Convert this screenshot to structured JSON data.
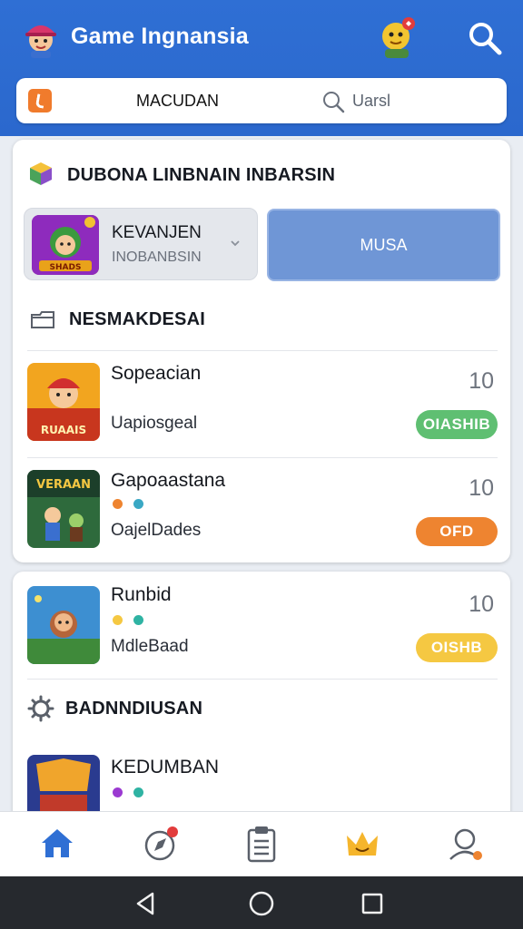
{
  "header": {
    "title": "Game Ingnansia",
    "logo_icon": "gamer-mascot-icon",
    "avatar_icon": "user-avatar-icon",
    "search_icon": "search-icon"
  },
  "search_bar": {
    "tab_label": "MACUDAN",
    "placeholder": "Uarsl"
  },
  "featured_section": {
    "title": "DUBONA LINBNAIN INBARSIN",
    "icon": "cube-icon",
    "featured": {
      "title": "KEVANJEN",
      "subtitle": "INOBANBSIN"
    },
    "action_label": "MUSA"
  },
  "list_section": {
    "title": "NESMAKDESAI",
    "icon": "folder-icon"
  },
  "rows": [
    {
      "title": "Sopeacian",
      "subtitle": "Uapiosgeal",
      "count": "10",
      "badge": "OIASHIB",
      "badge_color": "#5fbf72"
    },
    {
      "title": "Gapoaastana",
      "subtitle": "OajelDades",
      "count": "10",
      "badge": "OFD",
      "badge_color": "#ee8430"
    },
    {
      "title": "Runbid",
      "subtitle": "MdleBaad",
      "count": "10",
      "badge": "OISHB",
      "badge_color": "#f5c842"
    }
  ],
  "thumb_captions": {
    "row1": "RUAAIS",
    "row2": "VERAAN",
    "featured": "SHADS"
  },
  "second_section": {
    "title": "BADNNDIUSAN",
    "icon": "gear-icon",
    "item_title": "KEDUMBAN"
  },
  "bottom_nav": [
    "home-icon",
    "compass-icon",
    "clipboard-icon",
    "crown-icon",
    "profile-icon"
  ],
  "colors": {
    "primary": "#2f6fd4",
    "accent_orange": "#f07b2c",
    "action_blue": "#6f96d6"
  }
}
